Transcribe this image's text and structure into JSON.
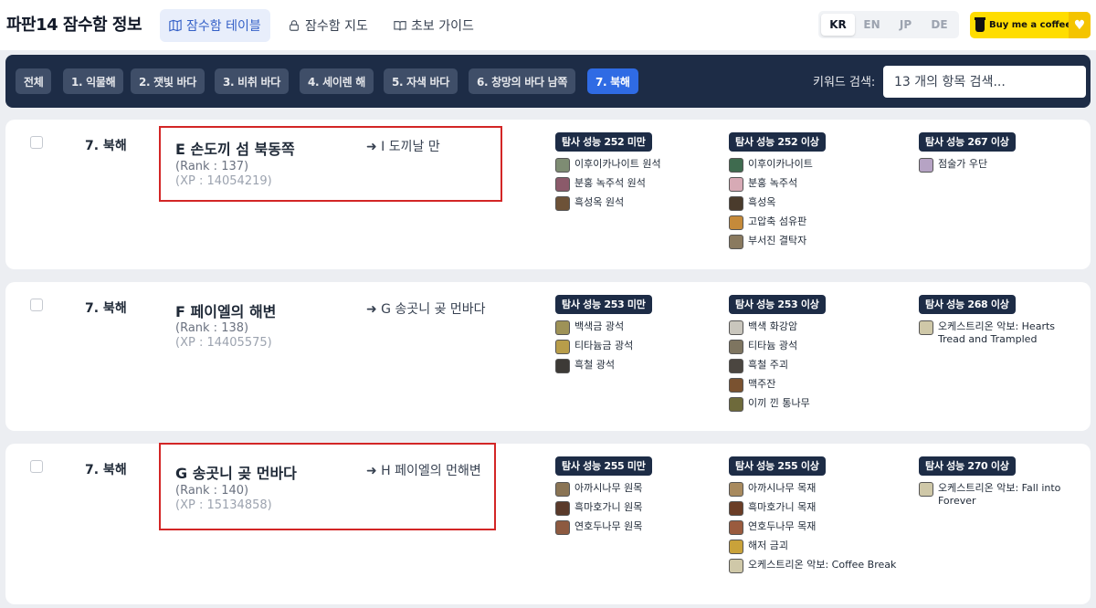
{
  "header": {
    "title": "파판14 잠수함 정보",
    "nav": [
      {
        "label": "잠수함 테이블",
        "icon": "map-icon",
        "active": true
      },
      {
        "label": "잠수함 지도",
        "icon": "lock-icon",
        "active": false
      },
      {
        "label": "초보 가이드",
        "icon": "book-icon",
        "active": false
      }
    ],
    "languages": [
      "KR",
      "EN",
      "JP",
      "DE"
    ],
    "selected_language": "KR",
    "coffee_label": "Buy me a coffee"
  },
  "filters": {
    "chips": [
      "전체",
      "1. 익물해",
      "2. 잿빛 바다",
      "3. 비취 바다",
      "4. 세이렌 해",
      "5. 자색 바다",
      "6. 창망의 바다 남쪽",
      "7. 북해"
    ],
    "active_chip": "7. 북해",
    "keyword_label": "키워드 검색:",
    "search_placeholder": "13 개의 항목 검색..."
  },
  "rows": [
    {
      "sea": "7. 북해",
      "name": "E 손도끼 섬 북동쪽",
      "rank": "(Rank : 137)",
      "xp": "(XP : 14054219)",
      "next": "➜ I 도끼날 만",
      "tiers": [
        {
          "label": "탐사 성능 252 미만",
          "items": [
            {
              "name": "이후이카나이트 원석",
              "color": "#7e8c73"
            },
            {
              "name": "분홍 녹주석 원석",
              "color": "#8b5a6a"
            },
            {
              "name": "흑성옥 원석",
              "color": "#6d5238"
            }
          ]
        },
        {
          "label": "탐사 성능 252 이상",
          "items": [
            {
              "name": "이후이카나이트",
              "color": "#3f6b4f"
            },
            {
              "name": "분홍 녹주석",
              "color": "#d7aab5"
            },
            {
              "name": "흑성옥",
              "color": "#4a3b2c"
            },
            {
              "name": "고압축 섬유판",
              "color": "#c58a3a"
            },
            {
              "name": "부서진 결탁자",
              "color": "#8a7a5f"
            }
          ]
        },
        {
          "label": "탐사 성능 267 이상",
          "items": [
            {
              "name": "점술가 우단",
              "color": "#b6a3c4"
            }
          ]
        }
      ]
    },
    {
      "sea": "7. 북해",
      "name": "F 페이엘의 해변",
      "rank": "(Rank : 138)",
      "xp": "(XP : 14405575)",
      "next": "➜ G 송곳니 곶 먼바다",
      "tiers": [
        {
          "label": "탐사 성능 253 미만",
          "items": [
            {
              "name": "백색금 광석",
              "color": "#9e9257"
            },
            {
              "name": "티타늄금 광석",
              "color": "#b89d4a"
            },
            {
              "name": "흑철 광석",
              "color": "#3d3a36"
            }
          ]
        },
        {
          "label": "탐사 성능 253 이상",
          "items": [
            {
              "name": "백색 화강암",
              "color": "#c9c6bd"
            },
            {
              "name": "티타늄 광석",
              "color": "#7e7560"
            },
            {
              "name": "흑철 주괴",
              "color": "#4b4640"
            },
            {
              "name": "맥주잔",
              "color": "#7a5230"
            },
            {
              "name": "이끼 낀 통나무",
              "color": "#6e6a3b"
            }
          ]
        },
        {
          "label": "탐사 성능 268 이상",
          "items": [
            {
              "name": "오케스트리온 악보: Hearts Tread and Trampled",
              "color": "#cfc8a8",
              "wrap": true
            }
          ]
        }
      ]
    },
    {
      "sea": "7. 북해",
      "name": "G 송곳니 곶 먼바다",
      "rank": "(Rank : 140)",
      "xp": "(XP : 15134858)",
      "next": "➜ H 페이엘의 먼해변",
      "tiers": [
        {
          "label": "탐사 성능 255 미만",
          "items": [
            {
              "name": "아까시나무 원목",
              "color": "#8a7454"
            },
            {
              "name": "흑마호가니 원목",
              "color": "#5a3a2a"
            },
            {
              "name": "연호두나무 원목",
              "color": "#8d5a40"
            }
          ]
        },
        {
          "label": "탐사 성능 255 이상",
          "items": [
            {
              "name": "아까시나무 목재",
              "color": "#a88a5e"
            },
            {
              "name": "흑마호가니 목재",
              "color": "#6b3d26"
            },
            {
              "name": "연호두나무 목재",
              "color": "#9a5b3e"
            },
            {
              "name": "해저 금괴",
              "color": "#c9a23a"
            },
            {
              "name": "오케스트리온 악보: Coffee Break",
              "color": "#cfc8a8",
              "wrap": true
            }
          ]
        },
        {
          "label": "탐사 성능 270 이상",
          "items": [
            {
              "name": "오케스트리온 악보: Fall into Forever",
              "color": "#cfc8a8",
              "wrap": true
            }
          ]
        }
      ]
    }
  ]
}
